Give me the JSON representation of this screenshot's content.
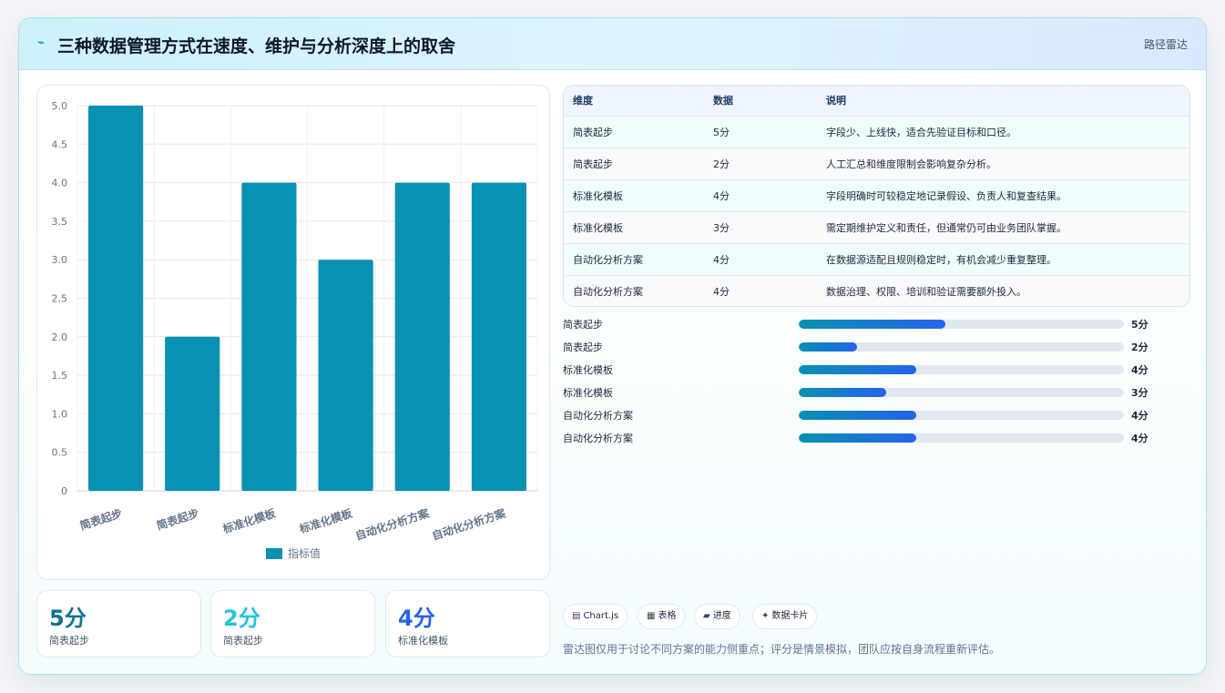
{
  "header": {
    "icon": "pulse-icon",
    "title": "三种数据管理方式在速度、维护与分析深度上的取舍",
    "tag": "路径雷达"
  },
  "chart_data": {
    "type": "bar",
    "categories": [
      "简表起步",
      "简表起步",
      "标准化模板",
      "标准化模板",
      "自动化分析方案",
      "自动化分析方案"
    ],
    "series": [
      {
        "name": "指标值",
        "values": [
          5,
          2,
          4,
          3,
          4,
          4
        ],
        "color": "#0891b2"
      }
    ],
    "ylim": [
      0,
      5
    ],
    "yticks": [
      "0",
      "0.5",
      "1.0",
      "1.5",
      "2.0",
      "2.5",
      "3.0",
      "3.5",
      "4.0",
      "4.5",
      "5.0"
    ],
    "grid": true,
    "legend_position": "bottom"
  },
  "table": {
    "headers": [
      "维度",
      "数据",
      "说明"
    ],
    "rows": [
      [
        "简表起步",
        "5分",
        "字段少、上线快，适合先验证目标和口径。"
      ],
      [
        "简表起步",
        "2分",
        "人工汇总和维度限制会影响复杂分析。"
      ],
      [
        "标准化模板",
        "4分",
        "字段明确时可较稳定地记录假设、负责人和复查结果。"
      ],
      [
        "标准化模板",
        "3分",
        "需定期维护定义和责任，但通常仍可由业务团队掌握。"
      ],
      [
        "自动化分析方案",
        "4分",
        "在数据源适配且规则稳定时，有机会减少重复整理。"
      ],
      [
        "自动化分析方案",
        "4分",
        "数据治理、权限、培训和验证需要额外投入。"
      ]
    ]
  },
  "progress": [
    {
      "label": "简表起步",
      "value": 5,
      "text": "5分"
    },
    {
      "label": "简表起步",
      "value": 2,
      "text": "2分"
    },
    {
      "label": "标准化模板",
      "value": 4,
      "text": "4分"
    },
    {
      "label": "标准化模板",
      "value": 3,
      "text": "3分"
    },
    {
      "label": "自动化分析方案",
      "value": 4,
      "text": "4分"
    },
    {
      "label": "自动化分析方案",
      "value": 4,
      "text": "4分"
    }
  ],
  "stats": [
    {
      "value": "5分",
      "label": "简表起步",
      "color": "#0e7490"
    },
    {
      "value": "2分",
      "label": "简表起步",
      "color": "#22c3dd"
    },
    {
      "value": "4分",
      "label": "标准化模板",
      "color": "#2563eb"
    }
  ],
  "chips": [
    {
      "icon": "chart-icon",
      "glyph": "▤",
      "label": "Chart.js"
    },
    {
      "icon": "table-icon",
      "glyph": "▦",
      "label": "表格"
    },
    {
      "icon": "progress-icon",
      "glyph": "▰",
      "label": "进度"
    },
    {
      "icon": "card-icon",
      "glyph": "✦",
      "label": "数据卡片"
    }
  ],
  "note": "雷达图仅用于讨论不同方案的能力侧重点；评分是情景模拟，团队应按自身流程重新评估。"
}
